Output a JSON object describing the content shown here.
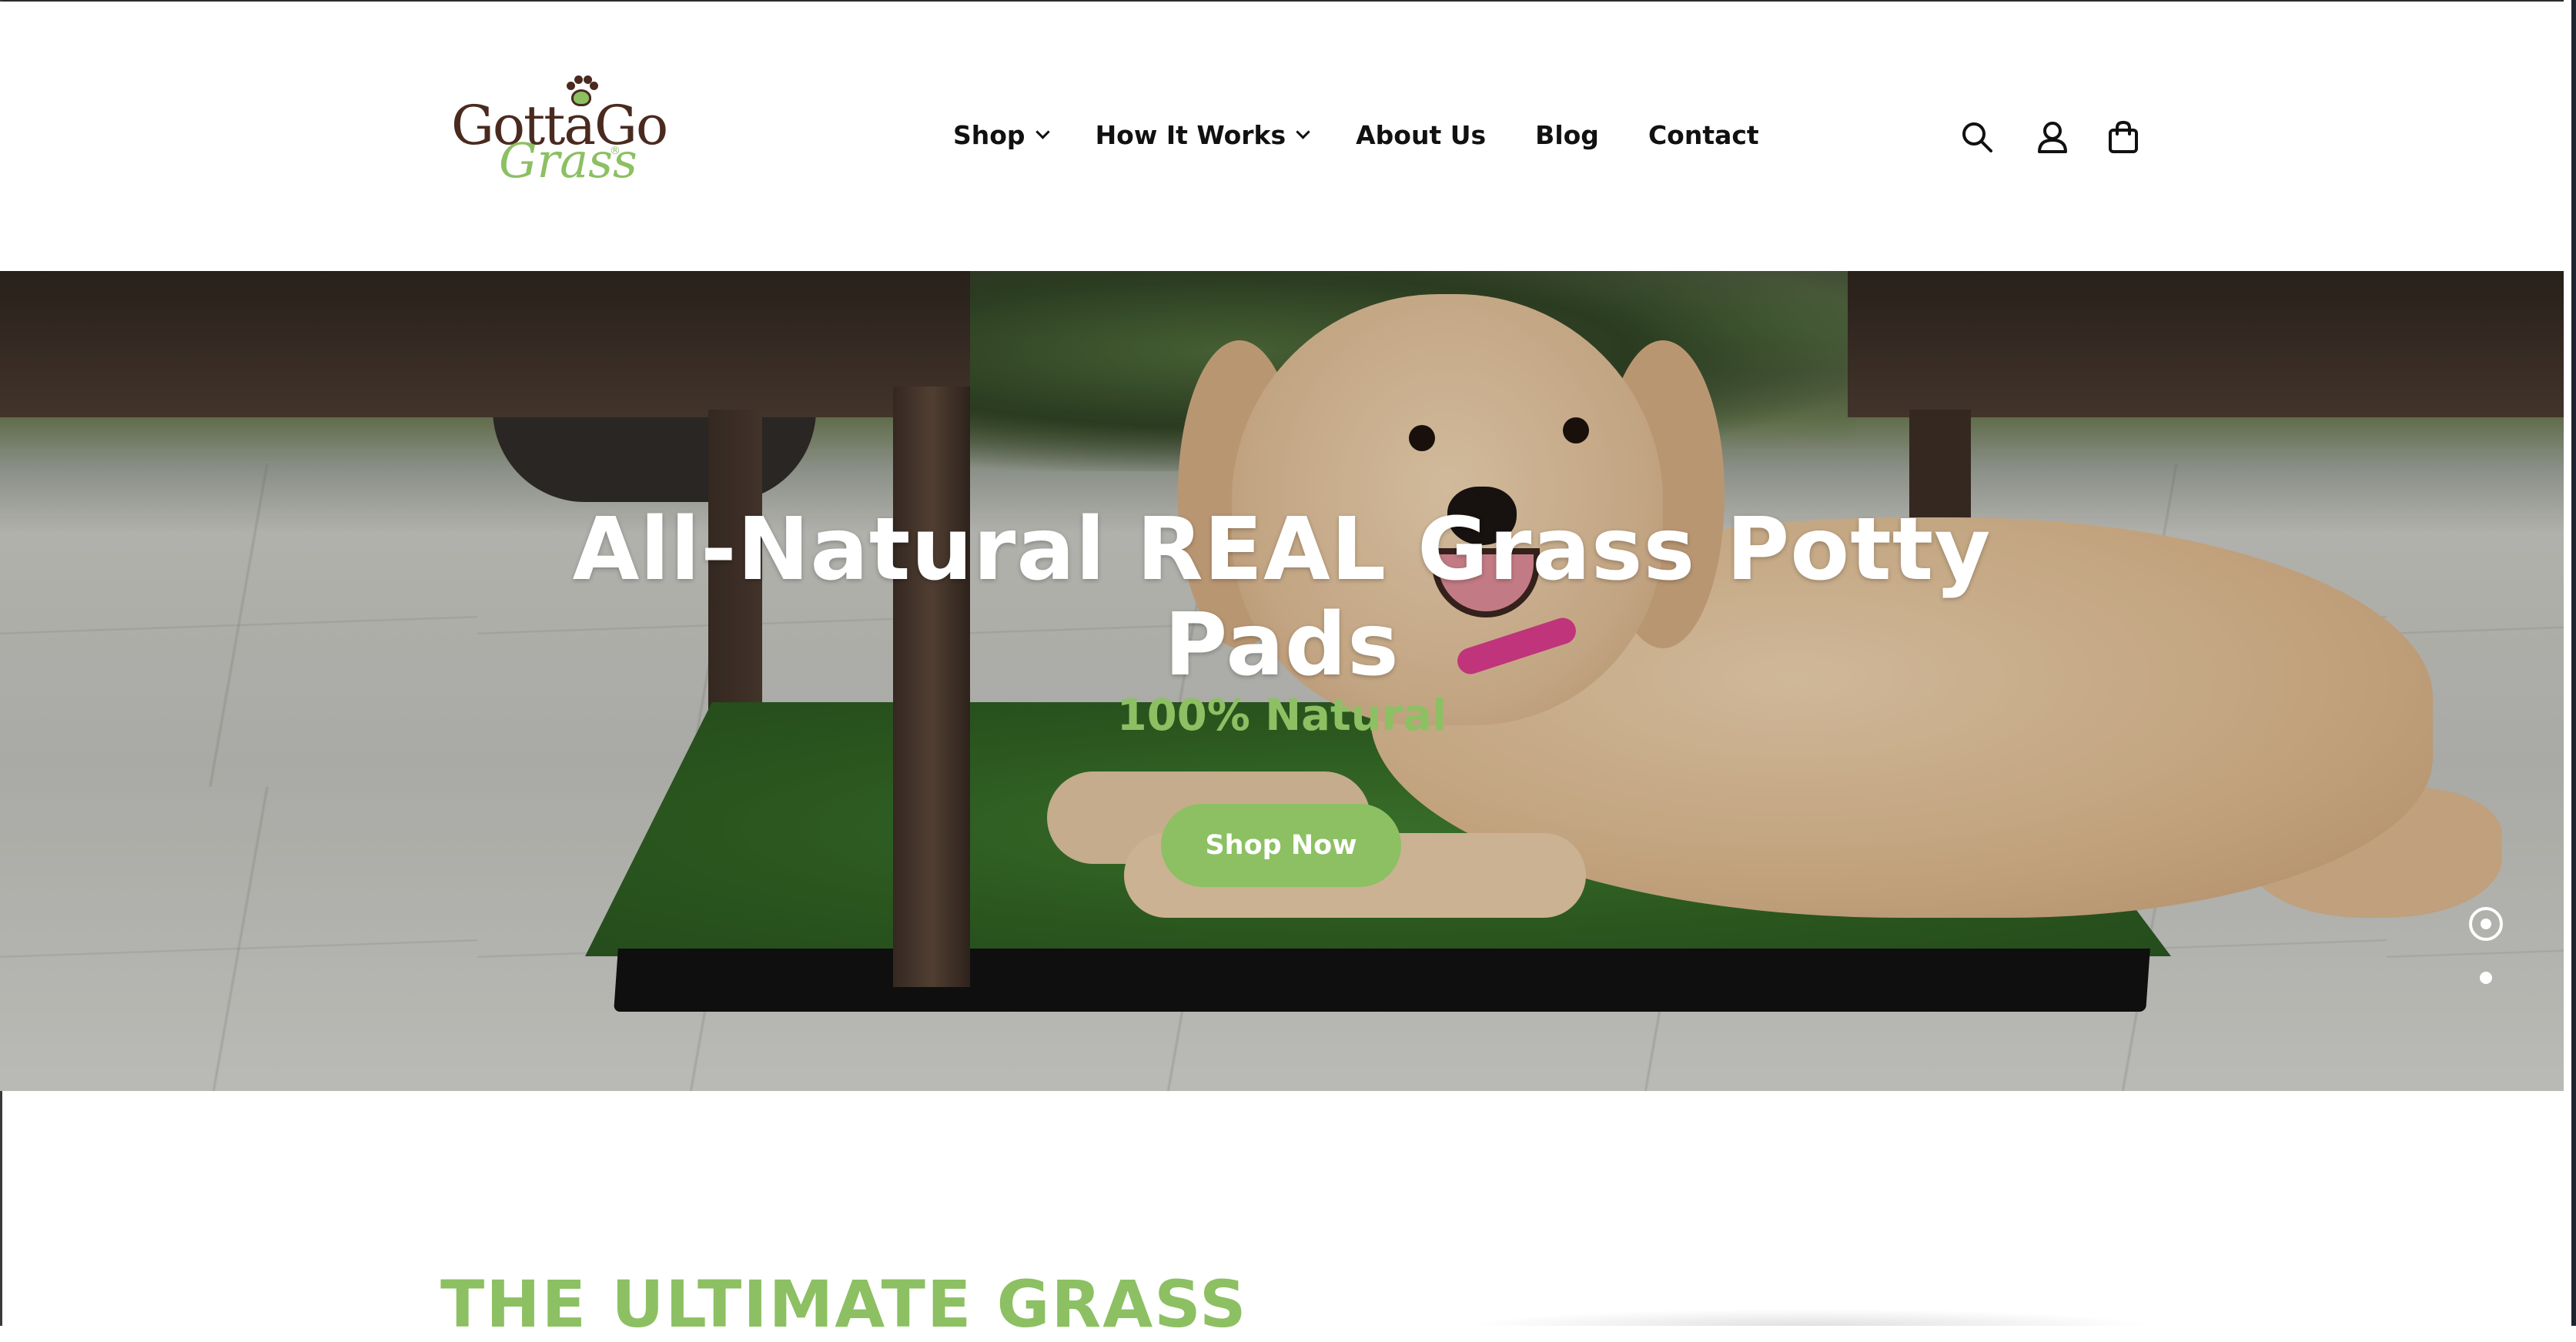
{
  "brand": {
    "logo_top": "GottaGo",
    "logo_bottom": "Grass",
    "logo_reg": "®",
    "brown": "#4a2a1f",
    "green": "#8cc063"
  },
  "nav": {
    "items": [
      {
        "label": "Shop",
        "has_dropdown": true
      },
      {
        "label": "How It Works",
        "has_dropdown": true
      },
      {
        "label": "About Us",
        "has_dropdown": false
      },
      {
        "label": "Blog",
        "has_dropdown": false
      },
      {
        "label": "Contact",
        "has_dropdown": false
      }
    ]
  },
  "header_icons": [
    "search-icon",
    "account-icon",
    "cart-icon"
  ],
  "hero": {
    "title": "All-Natural REAL Grass Potty Pads",
    "subtitle": "100% Natural",
    "cta": "Shop Now",
    "slides": {
      "count": 2,
      "active": 1
    }
  },
  "section": {
    "title": "THE ULTIMATE GRASS"
  }
}
